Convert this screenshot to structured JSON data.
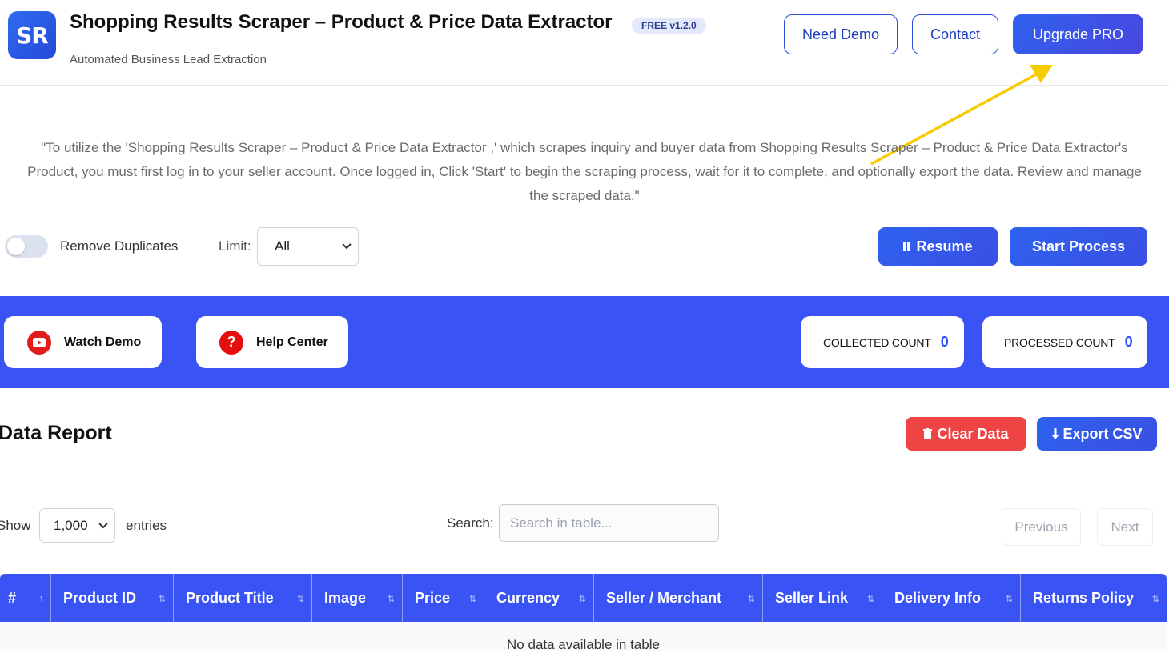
{
  "header": {
    "logo_text": "SR",
    "title": "Shopping Results Scraper – Product & Price Data Extractor",
    "version": "FREE v1.2.0",
    "subtitle": "Automated Business Lead Extraction",
    "need_demo_label": "Need Demo",
    "contact_label": "Contact",
    "upgrade_label": "Upgrade PRO"
  },
  "description": "\"To utilize the 'Shopping Results Scraper – Product & Price Data Extractor ,' which scrapes inquiry and buyer data from Shopping Results Scraper – Product & Price Data Extractor's Product, you must first log in to your seller account. Once logged in, Click 'Start' to begin the scraping process, wait for it to complete, and optionally export the data. Review and manage the scraped data.\"",
  "controls": {
    "remove_duplicates_label": "Remove Duplicates",
    "remove_duplicates_on": false,
    "limit_label": "Limit:",
    "limit_value": "All",
    "resume_label": "Resume",
    "start_label": "Start Process"
  },
  "band": {
    "watch_demo_label": "Watch Demo",
    "help_center_label": "Help Center",
    "help_icon_glyph": "?",
    "collected_label": "COLLECTED COUNT",
    "collected_value": "0",
    "processed_label": "PROCESSED COUNT",
    "processed_value": "0"
  },
  "report": {
    "title": "Data Report",
    "clear_label": "Clear Data",
    "export_label": "Export CSV",
    "show_label": "Show",
    "show_value": "1,000",
    "entries_label": "entries",
    "search_label": "Search:",
    "search_placeholder": "Search in table...",
    "previous_label": "Previous",
    "next_label": "Next",
    "columns": [
      "#",
      "Product ID",
      "Product Title",
      "Image",
      "Price",
      "Currency",
      "Seller / Merchant",
      "Seller Link",
      "Delivery Info",
      "Returns Policy"
    ],
    "empty_message": "No data available in table"
  },
  "colors": {
    "primary": "#3a53f5",
    "danger": "#ef4444",
    "annotation_arrow": "#f5cc00"
  }
}
